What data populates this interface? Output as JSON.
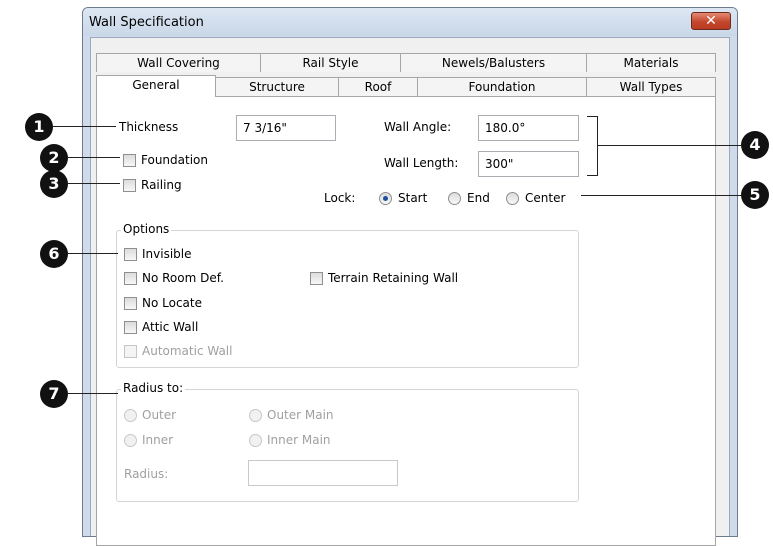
{
  "window": {
    "title": "Wall Specification",
    "close_glyph": "✕"
  },
  "tabs_row1": [
    "Wall Covering",
    "Rail Style",
    "Newels/Balusters",
    "Materials"
  ],
  "tabs_row2": [
    "General",
    "Structure",
    "Roof",
    "Foundation",
    "Wall Types"
  ],
  "fields": {
    "thickness_label": "Thickness",
    "thickness_value": "7 3/16\"",
    "foundation_label": "Foundation",
    "railing_label": "Railing",
    "wall_angle_label": "Wall Angle:",
    "wall_angle_value": "180.0°",
    "wall_length_label": "Wall Length:",
    "wall_length_value": "300\"",
    "lock_label": "Lock:",
    "lock_options": [
      "Start",
      "End",
      "Center"
    ],
    "lock_selected": "Start"
  },
  "options": {
    "legend": "Options",
    "invisible": "Invisible",
    "no_room_def": "No Room Def.",
    "terrain_retaining_wall": "Terrain Retaining Wall",
    "no_locate": "No Locate",
    "attic_wall": "Attic Wall",
    "automatic_wall": "Automatic Wall"
  },
  "radius": {
    "legend": "Radius to:",
    "outer": "Outer",
    "outer_main": "Outer Main",
    "inner": "Inner",
    "inner_main": "Inner Main",
    "radius_label": "Radius:",
    "radius_value": ""
  },
  "callouts": [
    "1",
    "2",
    "3",
    "4",
    "5",
    "6",
    "7"
  ]
}
